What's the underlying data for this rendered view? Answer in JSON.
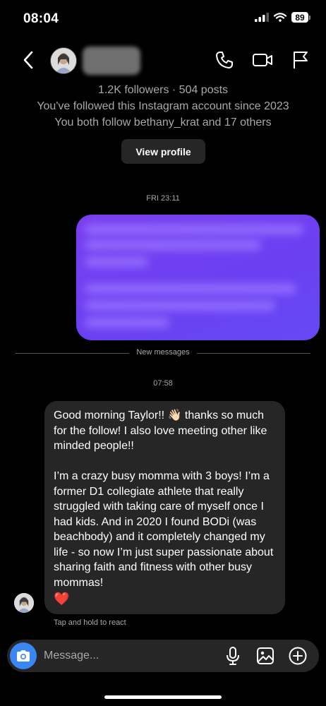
{
  "status_bar": {
    "time": "08:04",
    "battery": "89"
  },
  "header": {
    "back_icon": "chevron-left-icon",
    "call_icon": "phone-icon",
    "video_icon": "video-camera-icon",
    "report_icon": "flag-icon"
  },
  "profile": {
    "stats": "1.2K followers · 504 posts",
    "followed_since": "You've followed this Instagram account since 2023",
    "mutuals": "You both follow bethany_krat and 17 others",
    "view_profile_label": "View profile"
  },
  "thread": {
    "timestamp_1": "FRI 23:11",
    "new_messages_label": "New messages",
    "timestamp_2": "07:58",
    "received_paragraph_1": "Good morning Taylor!! 👋🏻 thanks so much for the follow! I also love meeting other like minded people!!",
    "received_paragraph_2": "I’m a crazy busy momma with 3 boys! I’m a former D1 collegiate athlete that really struggled with taking care of myself once I had kids. And in 2020 I found BODi (was beachbody) and it completely changed my life - so now I’m just super passionate about sharing faith and fitness with other busy mommas!",
    "received_heart": "❤️",
    "react_hint": "Tap and hold to react"
  },
  "composer": {
    "placeholder": "Message...",
    "camera_icon": "camera-icon",
    "mic_icon": "microphone-icon",
    "gallery_icon": "image-icon",
    "add_icon": "plus-circle-icon"
  },
  "colors": {
    "background": "#000000",
    "bubble_received": "#262626",
    "bubble_sent": "#6a40f2",
    "camera_button": "#3a86f2",
    "secondary_text": "#a8a8a8"
  }
}
